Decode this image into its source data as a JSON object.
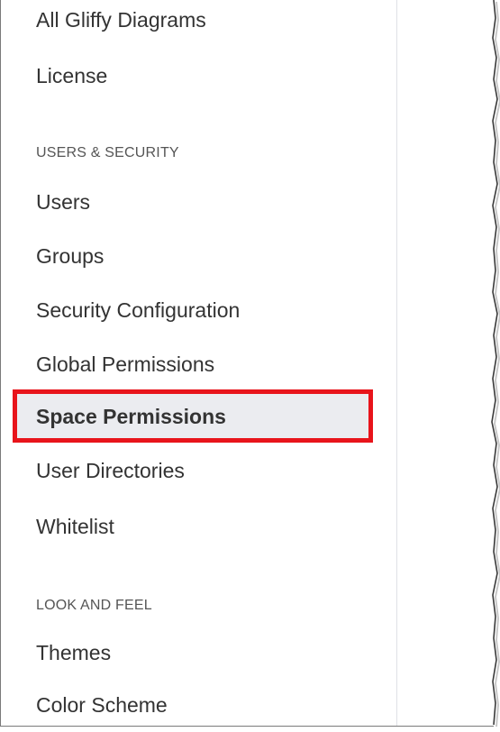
{
  "sidebar": {
    "top_items": [
      {
        "label": "All Gliffy Diagrams"
      },
      {
        "label": "License"
      }
    ],
    "users_security": {
      "heading": "USERS & SECURITY",
      "items": [
        {
          "label": "Users"
        },
        {
          "label": "Groups"
        },
        {
          "label": "Security Configuration"
        },
        {
          "label": "Global Permissions"
        },
        {
          "label": "Space Permissions",
          "active": true
        },
        {
          "label": "User Directories"
        },
        {
          "label": "Whitelist"
        }
      ]
    },
    "look_and_feel": {
      "heading": "LOOK AND FEEL",
      "items": [
        {
          "label": "Themes"
        },
        {
          "label": "Color Scheme"
        }
      ]
    }
  },
  "colors": {
    "active_background": "#ebecf0",
    "highlight_border": "#e8141b",
    "text": "#333333",
    "heading_text": "#555555"
  }
}
